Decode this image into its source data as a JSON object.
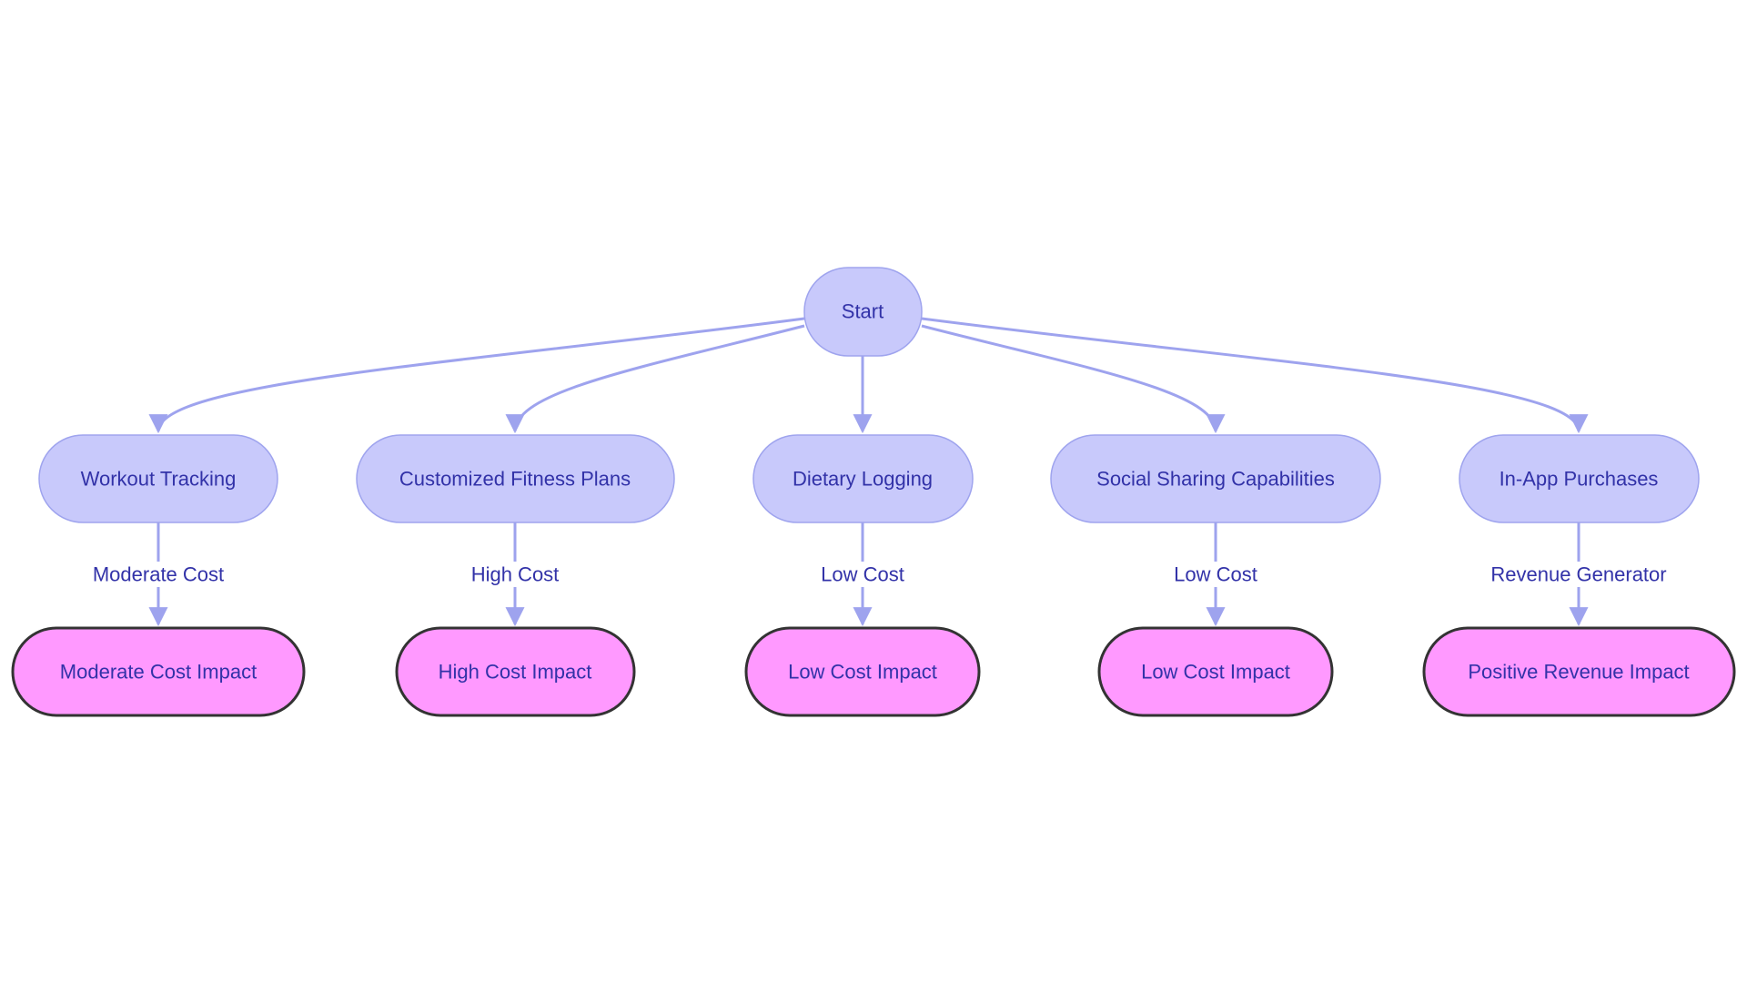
{
  "colors": {
    "feature_fill": "#c8c9fb",
    "feature_stroke": "#9fa4ee",
    "impact_fill": "#ff99ff",
    "impact_stroke": "#333333",
    "edge": "#9ea3ee",
    "text": "#3232a8"
  },
  "start": {
    "label": "Start"
  },
  "features": [
    {
      "label": "Workout Tracking",
      "edge_label": "Moderate Cost",
      "impact": "Moderate Cost Impact"
    },
    {
      "label": "Customized Fitness Plans",
      "edge_label": "High Cost",
      "impact": "High Cost Impact"
    },
    {
      "label": "Dietary Logging",
      "edge_label": "Low Cost",
      "impact": "Low Cost Impact"
    },
    {
      "label": "Social Sharing Capabilities",
      "edge_label": "Low Cost",
      "impact": "Low Cost Impact"
    },
    {
      "label": "In-App Purchases",
      "edge_label": "Revenue Generator",
      "impact": "Positive Revenue Impact"
    }
  ]
}
